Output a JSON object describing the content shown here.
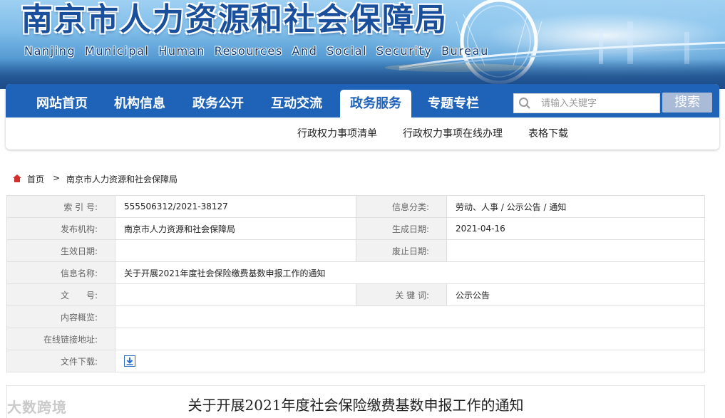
{
  "header": {
    "title_cn": "南京市人力资源和社会保障局",
    "title_en": "Nanjing Municipal Human Resources And Social Security Bureau"
  },
  "nav": {
    "items": [
      {
        "label": "网站首页"
      },
      {
        "label": "机构信息"
      },
      {
        "label": "政务公开"
      },
      {
        "label": "互动交流"
      },
      {
        "label": "政务服务",
        "active": true
      },
      {
        "label": "专题专栏"
      }
    ],
    "search_placeholder": "请输入关键字",
    "search_button": "搜索"
  },
  "subnav": {
    "items": [
      {
        "label": "行政权力事项清单"
      },
      {
        "label": "行政权力事项在线办理"
      },
      {
        "label": "表格下载"
      }
    ]
  },
  "breadcrumb": {
    "home": "首页",
    "separator": ">",
    "current": "南京市人力资源和社会保障局"
  },
  "info": {
    "index_label": "索 引 号:",
    "index_value": "555506312/2021-38127",
    "category_label": "信息分类:",
    "category_value": "劳动、人事 / 公示公告 / 通知",
    "publisher_label": "发布机构:",
    "publisher_value": "南京市人力资源和社会保障局",
    "created_label": "生成日期:",
    "created_value": "2021-04-16",
    "effective_label": "生效日期:",
    "effective_value": "",
    "expired_label": "废止日期:",
    "expired_value": "",
    "name_label": "信息名称:",
    "name_value": "关于开展2021年度社会保险缴费基数申报工作的通知",
    "docno_label": "文　　号:",
    "docno_value": "",
    "keywords_label": "关 键 词:",
    "keywords_value": "公示公告",
    "summary_label": "内容概览:",
    "summary_value": "",
    "link_label": "在线链接地址:",
    "link_value": "",
    "download_label": "文件下载:"
  },
  "article": {
    "title": "关于开展2021年度社会保险缴费基数申报工作的通知"
  },
  "watermark": "大数跨境",
  "colors": {
    "nav_blue": "#1f63b8",
    "title_blue": "#1a4f9b",
    "label_bg": "#f2f2f2",
    "search_btn": "#a9bbd6"
  }
}
